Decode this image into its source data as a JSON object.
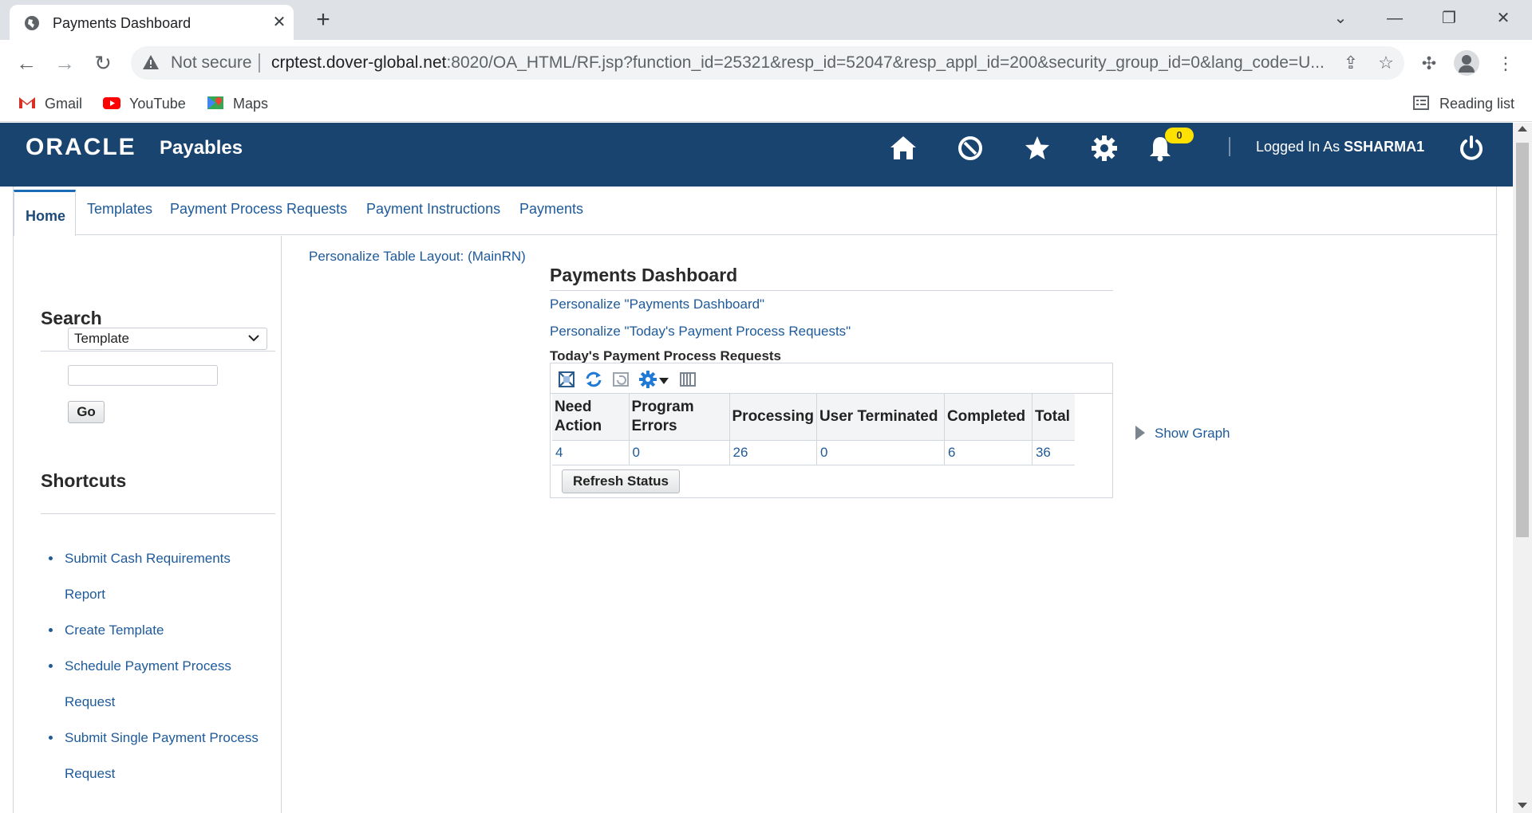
{
  "browser": {
    "tab_title": "Payments Dashboard",
    "not_secure": "Not secure",
    "url_host": "crptest.dover-global.net",
    "url_rest": ":8020/OA_HTML/RF.jsp?function_id=25321&resp_id=52047&resp_appl_id=200&security_group_id=0&lang_code=U...",
    "bookmarks": [
      "Gmail",
      "YouTube",
      "Maps"
    ],
    "reading_list": "Reading list"
  },
  "header": {
    "logo": "ORACLE",
    "app_name": "Payables",
    "notification_count": "0",
    "logged_in_prefix": "Logged In As ",
    "username": "SSHARMA1"
  },
  "tabs": [
    "Home",
    "Templates",
    "Payment Process Requests",
    "Payment Instructions",
    "Payments"
  ],
  "sidebar": {
    "search_heading": "Search",
    "select_value": "Template",
    "go_label": "Go",
    "shortcuts_heading": "Shortcuts",
    "shortcuts": [
      "Submit Cash Requirements",
      "Report",
      "Create Template",
      "Schedule Payment Process",
      "Request",
      "Submit Single Payment Process",
      "Request"
    ]
  },
  "main": {
    "personalize_layout": "Personalize Table Layout: (MainRN)",
    "title": "Payments Dashboard",
    "personalize_dashboard": "Personalize \"Payments Dashboard\"",
    "personalize_requests": "Personalize \"Today's Payment Process Requests\"",
    "table_title": "Today's Payment Process Requests",
    "columns": [
      "Need Action",
      "Program Errors",
      "Processing",
      "User Terminated",
      "Completed",
      "Total"
    ],
    "values": [
      "4",
      "0",
      "26",
      "0",
      "6",
      "36"
    ],
    "refresh_label": "Refresh Status",
    "show_graph": "Show Graph"
  },
  "colors": {
    "brand_bar": "#1a4470",
    "link": "#1e5a9a"
  }
}
